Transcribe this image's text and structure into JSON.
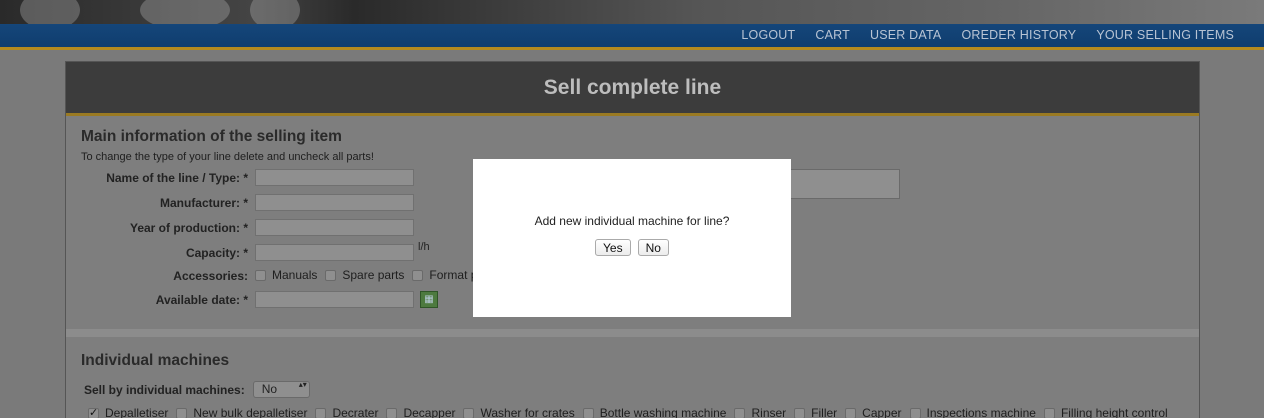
{
  "nav": {
    "links": [
      "LOGOUT",
      "CART",
      "USER DATA",
      "OREDER HISTORY",
      "YOUR SELLING ITEMS"
    ]
  },
  "panel": {
    "title": "Sell complete line"
  },
  "main_info": {
    "title": "Main information of the selling item",
    "hint": "To change the type of your line delete and uncheck all parts!",
    "fields": [
      {
        "label": "Name of the line / Type: *",
        "value": ""
      },
      {
        "label": "Manufacturer: *",
        "value": ""
      },
      {
        "label": "Year of production: *",
        "value": ""
      },
      {
        "label": "Capacity: *",
        "value": "",
        "unit": "l/h"
      }
    ],
    "accessories": {
      "label": "Accessories:",
      "items": [
        "Manuals",
        "Spare parts",
        "Format pa"
      ]
    },
    "available_date": {
      "label": "Available date: *",
      "value": ""
    }
  },
  "individual": {
    "title": "Individual machines",
    "sell_label": "Sell by individual machines:",
    "sell_value": "No",
    "machines": [
      {
        "label": "Depalletiser",
        "checked": true
      },
      {
        "label": "New bulk depalletiser",
        "checked": false
      },
      {
        "label": "Decrater",
        "checked": false
      },
      {
        "label": "Decapper",
        "checked": false
      },
      {
        "label": "Washer for crates",
        "checked": false
      },
      {
        "label": "Bottle washing machine",
        "checked": false
      },
      {
        "label": "Rinser",
        "checked": false
      },
      {
        "label": "Filler",
        "checked": false
      },
      {
        "label": "Capper",
        "checked": false
      },
      {
        "label": "Inspections machine",
        "checked": false
      },
      {
        "label": "Filling height control",
        "checked": false
      }
    ]
  },
  "modal": {
    "message": "Add new individual machine for line?",
    "yes": "Yes",
    "no": "No"
  }
}
